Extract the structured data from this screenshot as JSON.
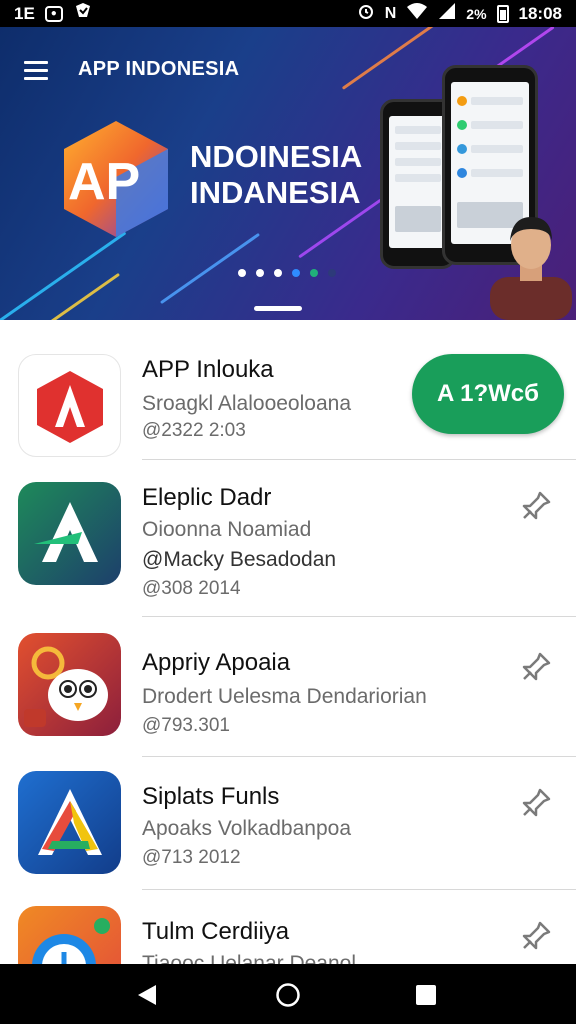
{
  "status_bar": {
    "left_icons": [
      "1E",
      "o"
    ],
    "signal_text": "2%",
    "time": "18:08",
    "icons": [
      "sim-icon",
      "camera-icon",
      "shield-icon",
      "alarm-icon",
      "nfc-icon",
      "wifi-icon",
      "signal-icon",
      "battery-icon"
    ]
  },
  "banner": {
    "title": "APP INDONESIA",
    "logo_text": "AP",
    "hero_line1": "NDOINESIA",
    "hero_line2": "INDANESIA",
    "slide_count": 6,
    "active_slide": 3,
    "colors": {
      "bg_start": "#0e2d6b",
      "bg_end": "#4b1f78",
      "logo_orange": "#f39c12",
      "logo_purple": "#6a3fd1"
    }
  },
  "apps": [
    {
      "name": "APP Inlouka",
      "subtitle": "Sroagkl Alalooeoloana",
      "meta": "@2322 2:03",
      "action": "install",
      "action_label": "A 1?Wcб",
      "icon": "red-a-app-icon"
    },
    {
      "name": "Eleplic Dadr",
      "subtitle": "Oioonna Noamiad",
      "subtitle2": "@Macky Besadodan",
      "meta": "@308 2014",
      "action": "pin",
      "icon": "green-a-app-icon"
    },
    {
      "name": "Appriy Apoaia",
      "subtitle": "Drodert Uelesma Dendariorian",
      "meta": "@793.301",
      "action": "pin",
      "icon": "bird-app-icon"
    },
    {
      "name": "Siplats Funls",
      "subtitle": "Apoaks Volkadbanpoa",
      "meta": "@713 2012",
      "action": "pin",
      "icon": "rainbow-a-app-icon"
    },
    {
      "name": "Tulm Cerdiiya",
      "subtitle": "Tiaooc Uelanar Deanol",
      "meta": "",
      "action": "pin",
      "icon": "clock-app-icon"
    }
  ],
  "nav": {
    "buttons": [
      "back-icon",
      "home-icon",
      "recents-icon"
    ]
  },
  "colors": {
    "install_green": "#199e5a",
    "divider": "#d8d8d8",
    "secondary_text": "#6b6b6b"
  }
}
